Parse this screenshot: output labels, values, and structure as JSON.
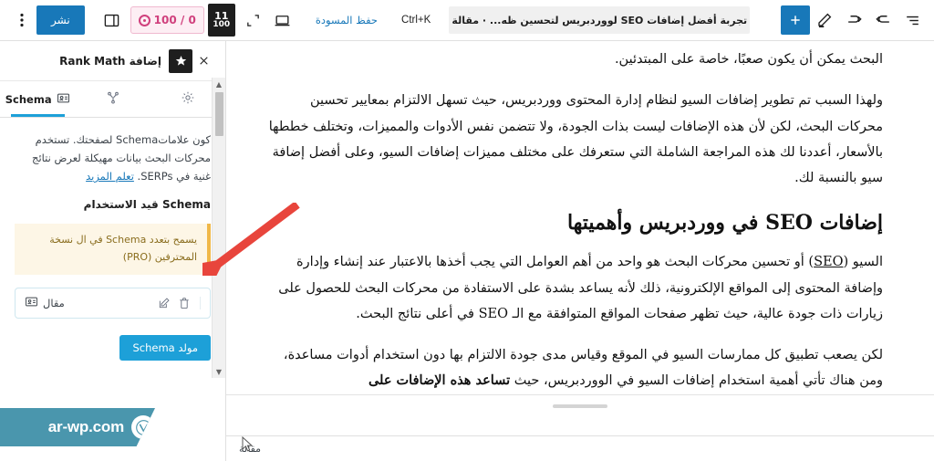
{
  "toolbar": {
    "options_icon": "kebab-menu-icon",
    "publish_label": "نشر",
    "sidebar_toggle_icon": "panel-toggle-icon",
    "seo_badge": {
      "icon": "target-icon",
      "value": "100 / 0"
    },
    "readability_score": {
      "num": "11",
      "den": "100"
    },
    "fullscreen_icon": "expand-icon",
    "preview_icon": "device-preview-icon",
    "save_draft_label": "حفظ المسودة",
    "shortcut_label": "Ctrl+K",
    "document_title": "تجربة أفضل إضافات SEO لووردبريس لتحسين ظه...  · مقالة",
    "list_view_icon": "list-view-icon",
    "undo_icon": "undo-icon",
    "redo_icon": "redo-icon",
    "edit_icon": "pencil-icon",
    "add_block_label": "+"
  },
  "sidebar": {
    "close_icon": "close-icon",
    "star_icon": "star-icon",
    "title": "إضافة Rank Math",
    "tabs": [
      {
        "label": "Schema",
        "icon": "schema-card-icon",
        "active": true
      },
      {
        "label": "",
        "icon": "social-share-icon",
        "active": false
      },
      {
        "label": "",
        "icon": "gear-icon",
        "active": false
      }
    ],
    "description_pre": "كون علامات",
    "description_brand": "Schema",
    "description_mid": " لصفحتك. تستخدم محركات البحث بيانات مهيكلة لعرض نتائج غنية في SERPs. ",
    "description_link": "تعلم المزيد",
    "description_full": "كون علامات Schema لصفحتك. تستخدم محركات البحث بيانات مهيكلة لعرض نتائج غنية في SERPs. تعلم المزيد",
    "in_use_label": "Schema قيد الاستخدام",
    "pro_notice": "يسمح بتعدد Schema في ال نسخة المحترفين (PRO)",
    "pro_notice_link": "نسخة المحترفين (PRO)",
    "schema_item": {
      "icon": "article-card-icon",
      "label": "مقال",
      "delete_icon": "trash-icon",
      "edit_icon": "edit-pencil-icon"
    },
    "generator_button": "مولد Schema",
    "scroll_up_icon": "scroll-up-arrow",
    "scroll_down_icon": "scroll-down-arrow"
  },
  "content": {
    "paragraphs": [
      "البحث يمكن أن يكون صعبًا، خاصة على المبتدئين.",
      "ولهذا السبب تم تطوير إضافات السيو لنظام إدارة المحتوى ووردبريس، حيث تسهل الالتزام بمعايير تحسين محركات البحث، لكن لأن هذه الإضافات ليست بذات الجودة، ولا تتضمن نفس الأدوات والمميزات، وتختلف خططها بالأسعار، أعددنا لك هذه المراجعة الشاملة التي ستعرفك على مختلف مميزات إضافات السيو، وعلى أفضل إضافة سيو بالنسبة لك."
    ],
    "heading": "إضافات SEO في ووردبريس وأهميتها",
    "paragraph_3_a": "السيو (",
    "paragraph_3_seo": "SEO",
    "paragraph_3_b": ") أو تحسين محركات البحث هو واحد من أهم العوامل التي يجب أخذها بالاعتبار عند إنشاء وإدارة وإضافة المحتوى إلى المواقع الإلكترونية، ذلك لأنه يساعد بشدة على الاستفادة من محركات البحث للحصول على زيارات ذات جودة عالية، حيث تظهر صفحات المواقع المتوافقة مع الـ SEO في أعلى نتائج البحث.",
    "paragraph_4_a": "لكن يصعب تطبيق كل ممارسات السيو في الموقع وقياس مدى جودة الالتزام بها دون استخدام أدوات مساعدة، ومن هناك تأتي أهمية استخدام إضافات السيو في الووردبريس، حيث ",
    "paragraph_4_bold": "تساعد هذه الإضافات على"
  },
  "bottom": {
    "breadcrumb": "مقالة"
  },
  "watermark": {
    "text": "ar-wp.com",
    "logo": "v-logo-icon"
  },
  "annotation": {
    "arrow_color": "#e8453c",
    "arrow_name": "red-pointer-arrow"
  },
  "cursor": {
    "icon": "mouse-pointer"
  }
}
